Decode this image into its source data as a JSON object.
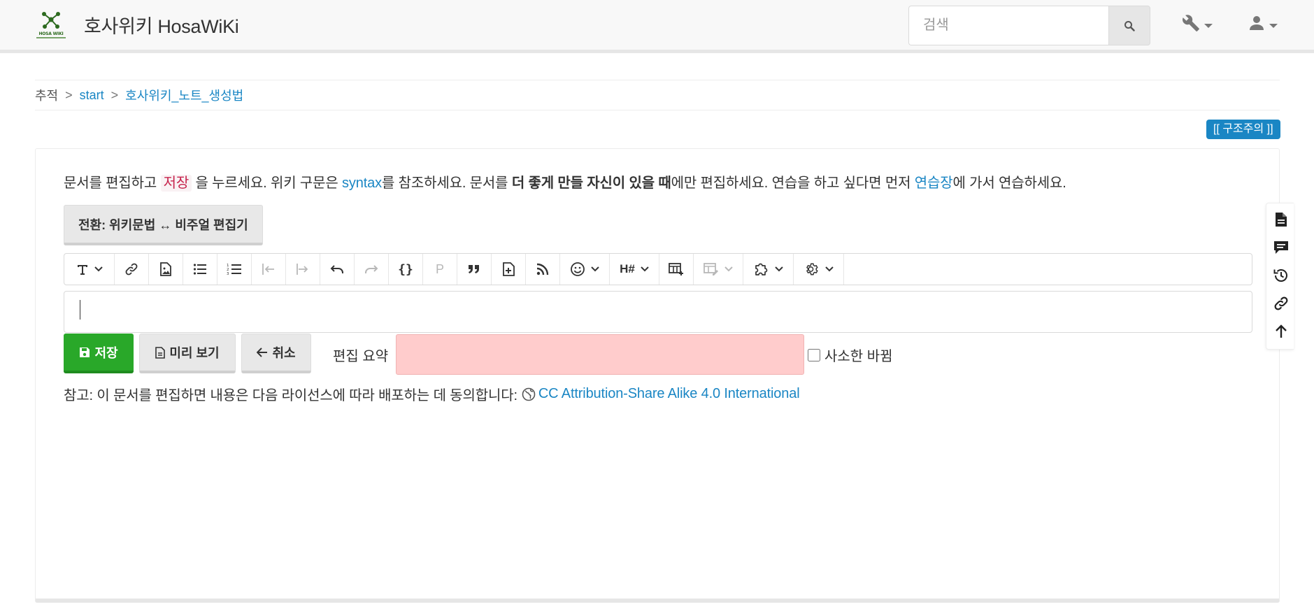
{
  "header": {
    "logo_text": "HOSA WIKI",
    "site_title": "호사위키 HosaWiKi",
    "search_placeholder": "검색"
  },
  "breadcrumb": {
    "label": "추적",
    "separator": ">",
    "items": [
      "start",
      "호사위키_노트_생성법"
    ]
  },
  "badge": {
    "label": "[[ 구조주의 ]]"
  },
  "intro": {
    "part1": "문서를 편집하고 ",
    "save_word": "저장",
    "part2": " 을 누르세요. 위키 구문은 ",
    "syntax_link": "syntax",
    "part3": "를 참조하세요. 문서를 ",
    "bold": "더 좋게 만들 자신이 있을 때",
    "part4": "에만 편집하세요. 연습을 하고 싶다면 먼저 ",
    "playground_link": "연습장",
    "part5": "에 가서 연습하세요."
  },
  "switch_button": {
    "label": "전환: 위키문법 ↔ 비주얼 편집기"
  },
  "toolbar": {
    "heading_glyph": "H#",
    "paragraph_glyph": "P",
    "code_glyph": "{}"
  },
  "actions": {
    "save_label": "저장",
    "preview_label": "미리 보기",
    "cancel_label": "취소",
    "summary_label": "편집 요약",
    "minor_label": "사소한 바뀜"
  },
  "license": {
    "text": "참고: 이 문서를 편집하면 내용은 다음 라이선스에 따라 배포하는 데 동의합니다:",
    "link": "CC Attribution-Share Alike 4.0 International"
  },
  "colors": {
    "link": "#1a86c4",
    "save_green": "#29a829",
    "summary_bg": "#ffcccc",
    "badge_bg": "#1a86c4"
  }
}
